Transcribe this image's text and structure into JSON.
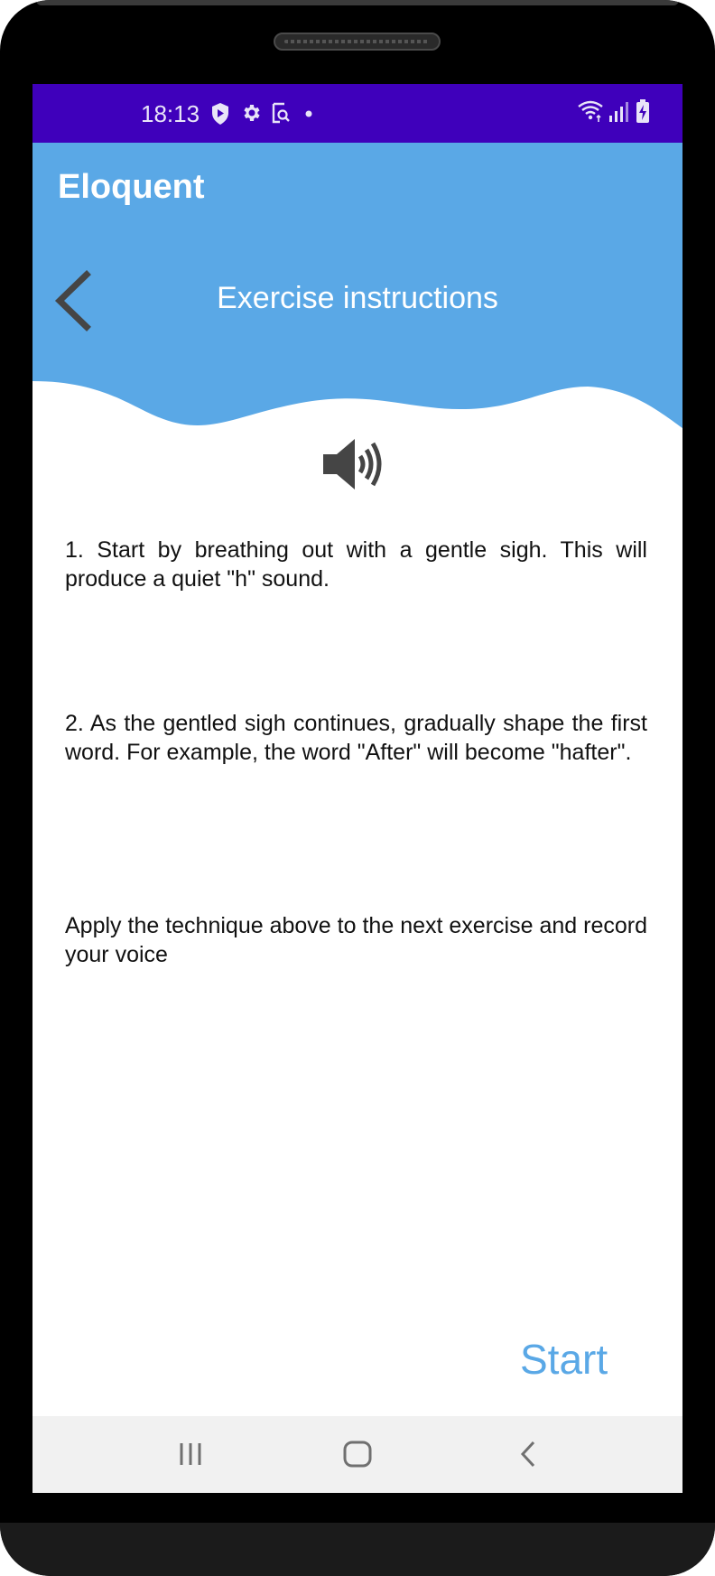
{
  "status_bar": {
    "time": "18:13",
    "icons": [
      "shield-play-icon",
      "gear-icon",
      "screenshot-search-icon",
      "dot-icon",
      "wifi-icon",
      "signal-icon",
      "battery-charging-icon"
    ]
  },
  "app_bar": {
    "title": "Eloquent"
  },
  "header": {
    "title": "Exercise instructions",
    "back_icon": "chevron-left-icon"
  },
  "sound_icon": "speaker-volume-icon",
  "instructions": [
    "1.  Start by breathing out with a gentle sigh. This will produce a quiet \"h\" sound.",
    "2.  As the gentled sigh continues, gradually shape the first word. For example, the word \"After\" will become \"hafter\".",
    "Apply the technique above to the next exercise and record your voice"
  ],
  "start_button": {
    "label": "Start"
  },
  "nav_bar": {
    "icons": [
      "recent-apps-icon",
      "home-icon",
      "back-icon"
    ]
  },
  "colors": {
    "status_bar": "#3f00bb",
    "accent": "#5aa8e6",
    "nav_bar": "#f1f1f1"
  }
}
